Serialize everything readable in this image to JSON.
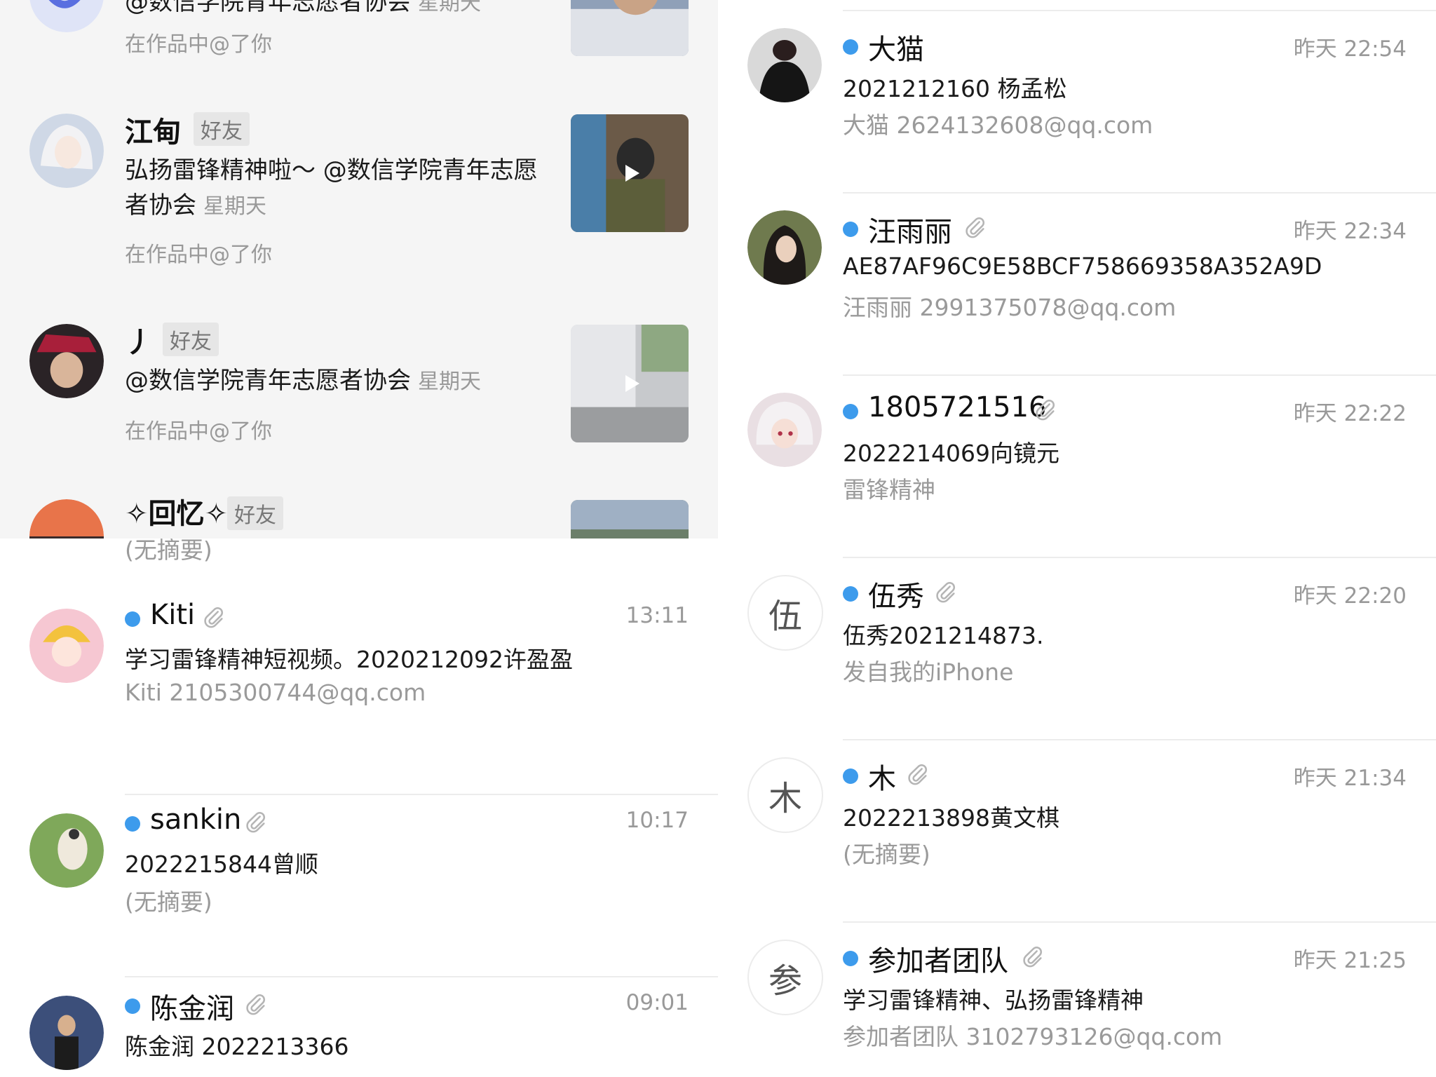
{
  "social": {
    "top_partial": {
      "text": "@数信学院青年志愿者协会",
      "time": "星期天",
      "sub": "在作品中@了你"
    },
    "items": [
      {
        "name": "江甸",
        "badge": "好友",
        "text": "弘扬雷锋精神啦～ @数信学院青年志愿者协会",
        "time": "星期天",
        "sub": "在作品中@了你"
      },
      {
        "name": "丿",
        "badge": "好友",
        "text": "@数信学院青年志愿者协会",
        "time": "星期天",
        "sub": "在作品中@了你"
      },
      {
        "name": "✧回忆✧",
        "badge": "好友"
      }
    ]
  },
  "mail_left": {
    "partial_preview": "(无摘要)",
    "items": [
      {
        "sender": "Kiti",
        "time": "13:11",
        "subject": "学习雷锋精神短视频。2020212092许盈盈",
        "preview": "Kiti 2105300744@qq.com"
      },
      {
        "sender": "sankin",
        "time": "10:17",
        "subject": "2022215844曾顺",
        "preview": "(无摘要)"
      },
      {
        "sender": "陈金润",
        "time": "09:01",
        "subject": "陈金润 2022213366",
        "preview": ""
      }
    ]
  },
  "mail_right": {
    "items": [
      {
        "sender": "大猫",
        "time": "昨天 22:54",
        "subject": "2021212160  杨孟松",
        "preview": "大猫 2624132608@qq.com"
      },
      {
        "sender": "汪雨丽",
        "time": "昨天 22:34",
        "subject": "AE87AF96C9E58BCF758669358A352A9D",
        "preview": "汪雨丽 2991375078@qq.com"
      },
      {
        "sender": "1805721516",
        "time": "昨天 22:22",
        "subject": "2022214069向镜元",
        "preview": "雷锋精神"
      },
      {
        "sender": "伍秀",
        "time": "昨天 22:20",
        "subject": "伍秀2021214873.",
        "preview": "发自我的iPhone",
        "avatar_letter": "伍"
      },
      {
        "sender": "木",
        "time": "昨天 21:34",
        "subject": "2022213898黄文棋",
        "preview": "(无摘要)",
        "avatar_letter": "木"
      },
      {
        "sender": "参加者团队",
        "time": "昨天 21:25",
        "subject": "学习雷锋精神、弘扬雷锋精神",
        "preview": "参加者团队 3102793126@qq.com",
        "avatar_letter": "参"
      }
    ]
  },
  "colors": {
    "unread_dot": "#3d9bec",
    "muted_text": "#999999",
    "social_bg": "#f5f5f5"
  }
}
